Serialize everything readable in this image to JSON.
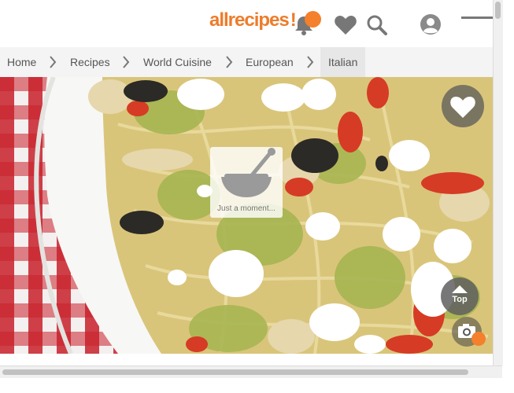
{
  "header": {
    "logo_text": "allrecipes",
    "logo_mark": "!",
    "icons": [
      "bell-icon",
      "heart-icon",
      "search-icon",
      "user-avatar-icon",
      "hamburger-menu-icon"
    ]
  },
  "breadcrumb": {
    "items": [
      {
        "label": "Home"
      },
      {
        "label": "Recipes"
      },
      {
        "label": "World Cuisine"
      },
      {
        "label": "European"
      },
      {
        "label": "Italian"
      }
    ]
  },
  "hero": {
    "loading_text": "Just a moment...",
    "top_button_label": "Top"
  },
  "colors": {
    "brand": "#ee7c2a",
    "notification": "#f4802d",
    "icon_gray": "#777777",
    "breadcrumb_bg": "#f4f4f4"
  }
}
